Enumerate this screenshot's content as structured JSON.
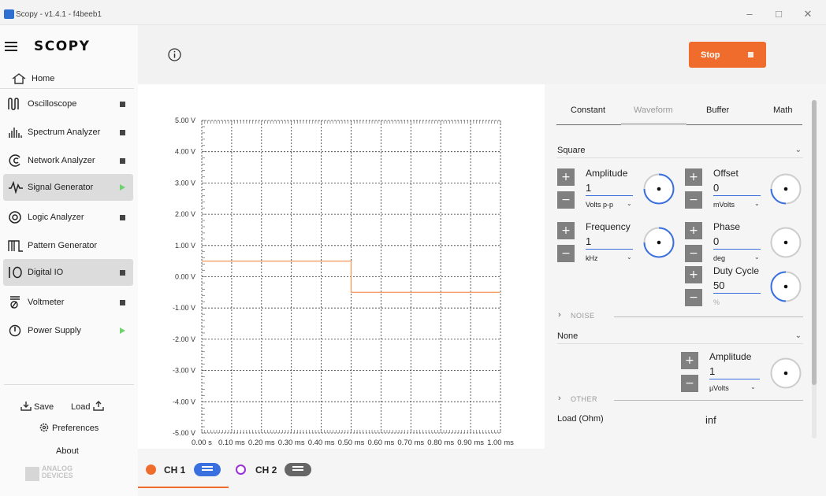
{
  "window": {
    "title": "Scopy - v1.4.1 - f4beeb1"
  },
  "sidebar": {
    "logo": "SCOPY",
    "home": "Home",
    "items": [
      {
        "label": "Oscilloscope",
        "status": "stopped",
        "icon": "oscilloscope-icon"
      },
      {
        "label": "Spectrum Analyzer",
        "status": "stopped",
        "icon": "spectrum-icon"
      },
      {
        "label": "Network Analyzer",
        "status": "stopped",
        "icon": "network-icon"
      },
      {
        "label": "Signal Generator",
        "status": "running",
        "selected": true,
        "icon": "signal-icon"
      },
      {
        "label": "Logic Analyzer",
        "status": "stopped",
        "icon": "logic-icon"
      },
      {
        "label": "Pattern Generator",
        "status": "none",
        "icon": "pattern-icon"
      },
      {
        "label": "Digital IO",
        "status": "stopped",
        "selected": true,
        "icon": "digital-io-icon"
      },
      {
        "label": "Voltmeter",
        "status": "stopped",
        "icon": "voltmeter-icon"
      },
      {
        "label": "Power Supply",
        "status": "running",
        "icon": "power-icon"
      }
    ],
    "save": "Save",
    "load": "Load",
    "preferences": "Preferences",
    "about": "About",
    "brand_top": "ANALOG",
    "brand_bottom": "DEVICES"
  },
  "header": {
    "run_button": "Stop",
    "accent": "#f06c2d"
  },
  "tabs": [
    "Constant",
    "Waveform",
    "Buffer",
    "Math"
  ],
  "active_tab": "Waveform",
  "waveform": {
    "type": "Square",
    "amplitude": {
      "label": "Amplitude",
      "value": "1",
      "unit": "Volts p-p"
    },
    "offset": {
      "label": "Offset",
      "value": "0",
      "unit": "mVolts"
    },
    "frequency": {
      "label": "Frequency",
      "value": "1",
      "unit": "kHz"
    },
    "phase": {
      "label": "Phase",
      "value": "0",
      "unit": "deg"
    },
    "duty_cycle": {
      "label": "Duty Cycle",
      "value": "50",
      "unit": "%"
    }
  },
  "noise": {
    "section": "NOISE",
    "type": "None",
    "amplitude": {
      "label": "Amplitude",
      "value": "1",
      "unit": "µVolts"
    }
  },
  "other": {
    "section": "OTHER",
    "load_label": "Load (Ohm)",
    "load_value": "inf"
  },
  "channels": [
    {
      "label": "CH 1",
      "color": "#f06c2d",
      "enabled": true
    },
    {
      "label": "CH 2",
      "color": "#9b30d9",
      "enabled": false
    }
  ],
  "chart_data": {
    "type": "line",
    "title": "",
    "xlabel": "",
    "ylabel": "",
    "x_ticks": [
      "0.00 s",
      "0.10 ms",
      "0.20 ms",
      "0.30 ms",
      "0.40 ms",
      "0.50 ms",
      "0.60 ms",
      "0.70 ms",
      "0.80 ms",
      "0.90 ms",
      "1.00 ms"
    ],
    "y_ticks": [
      "5.00 V",
      "4.00 V",
      "3.00 V",
      "2.00 V",
      "1.00 V",
      "0.00 V",
      "-1.00 V",
      "-2.00 V",
      "-3.00 V",
      "-4.00 V",
      "-5.00 V"
    ],
    "xlim": [
      0,
      1
    ],
    "ylim": [
      -5,
      5
    ],
    "grid": true,
    "series": [
      {
        "x": [
          0,
          0.5,
          0.5,
          1.0
        ],
        "y": [
          0.5,
          0.5,
          -0.5,
          -0.5
        ],
        "color": "#f2a068"
      }
    ]
  }
}
